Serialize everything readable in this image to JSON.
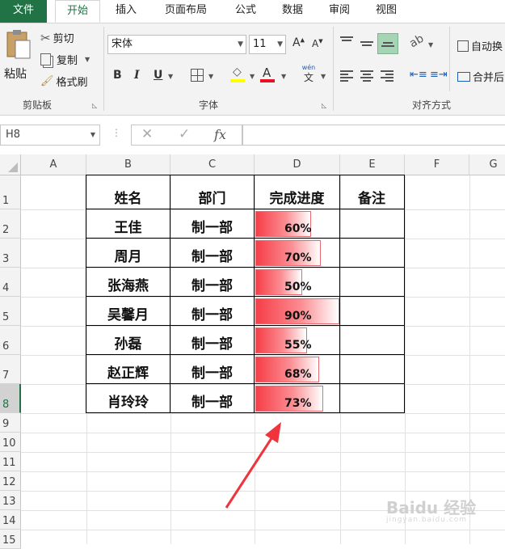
{
  "tabs": [
    "文件",
    "开始",
    "插入",
    "页面布局",
    "公式",
    "数据",
    "审阅",
    "视图"
  ],
  "clipboard": {
    "paste": "粘贴",
    "cut": "剪切",
    "copy": "复制",
    "format_painter": "格式刷",
    "group": "剪贴板"
  },
  "font": {
    "name": "宋体",
    "size": "11",
    "group": "字体",
    "wen": "wén",
    "wen_char": "文"
  },
  "alignment": {
    "wrap": "自动换",
    "merge": "合并后",
    "group": "对齐方式"
  },
  "formula_bar": {
    "name_box": "H8",
    "fx": "fx",
    "value": ""
  },
  "columns": [
    "A",
    "B",
    "C",
    "D",
    "E",
    "F",
    "G"
  ],
  "rows": [
    "1",
    "2",
    "3",
    "4",
    "5",
    "6",
    "7",
    "8",
    "9",
    "10",
    "11",
    "12",
    "13",
    "14",
    "15"
  ],
  "selected_row": "8",
  "table": {
    "headers": [
      "姓名",
      "部门",
      "完成进度",
      "备注"
    ],
    "rows": [
      {
        "name": "王佳",
        "dept": "制一部",
        "progress": "60%",
        "fraction": 0.6
      },
      {
        "name": "周月",
        "dept": "制一部",
        "progress": "70%",
        "fraction": 0.7
      },
      {
        "name": "张海燕",
        "dept": "制一部",
        "progress": "50%",
        "fraction": 0.5
      },
      {
        "name": "吴馨月",
        "dept": "制一部",
        "progress": "90%",
        "fraction": 0.9
      },
      {
        "name": "孙磊",
        "dept": "制一部",
        "progress": "55%",
        "fraction": 0.55
      },
      {
        "name": "赵正辉",
        "dept": "制一部",
        "progress": "68%",
        "fraction": 0.68
      },
      {
        "name": "肖玲玲",
        "dept": "制一部",
        "progress": "73%",
        "fraction": 0.73
      }
    ]
  },
  "watermark": {
    "text": "Baidu 经验",
    "sub": "jingyan.baidu.com"
  },
  "colors": {
    "accent": "#217346",
    "bar_start": "#f63e48",
    "arrow": "#f0333c"
  }
}
